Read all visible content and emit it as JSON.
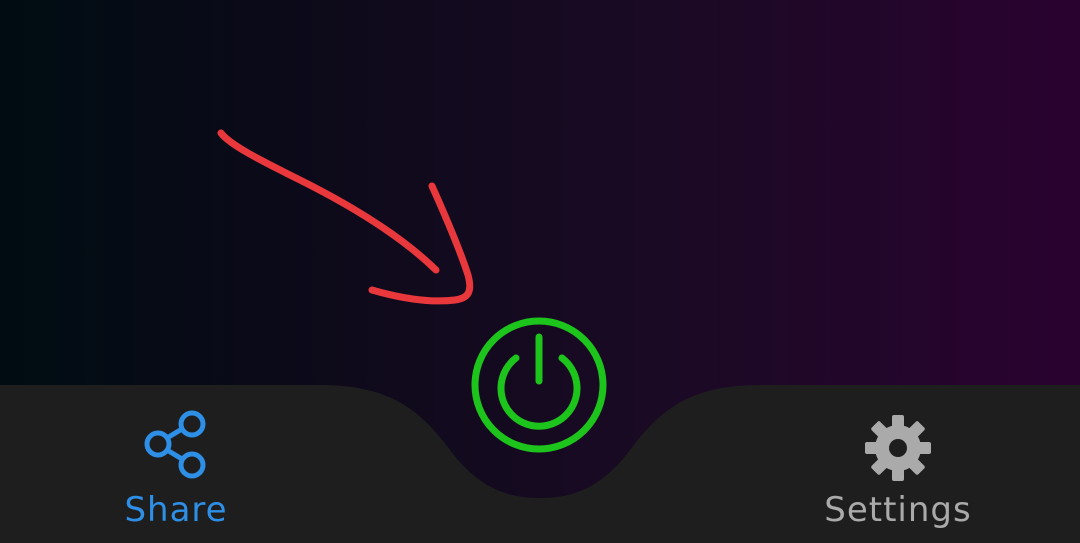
{
  "nav": {
    "share": {
      "label": "Share",
      "icon": "share-icon",
      "color": "#2e8fe6"
    },
    "settings": {
      "label": "Settings",
      "icon": "gear-icon",
      "color": "#aaaaaa"
    }
  },
  "power": {
    "icon": "power-icon",
    "color": "#1cc41c"
  },
  "colors": {
    "bar": "#1e1e1e",
    "annotation": "#e8383c"
  }
}
